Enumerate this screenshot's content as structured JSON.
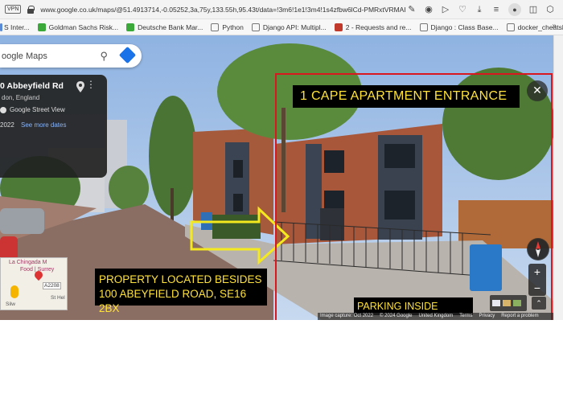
{
  "browser": {
    "vpn_label": "VPN",
    "url": "www.google.co.uk/maps/@51.4913714,-0.05252,3a,75y,133.55h,95.43t/data=!3m6!1e1!3m4!1s4zfbw6lCd-PMRxtVRMAIGA!2e0!7i",
    "toolbar_icons": [
      "edit-icon",
      "camera-icon",
      "play-icon",
      "heart-icon",
      "download-icon",
      "menu-icon",
      "profile-icon",
      "extension-icon",
      "settings-icon"
    ]
  },
  "bookmarks": [
    {
      "label": "S Inter...",
      "color": "#5a8bd6"
    },
    {
      "label": "Goldman Sachs Risk...",
      "color": "#3aa93a"
    },
    {
      "label": "Deutsche Bank Mar...",
      "color": "#3aa93a"
    },
    {
      "label": "Python",
      "color": "#555555"
    },
    {
      "label": "Django API: Multipl...",
      "color": "#555555"
    },
    {
      "label": "2 - Requests and re...",
      "color": "#c0392b"
    },
    {
      "label": "Django : Class Base...",
      "color": "#555555"
    },
    {
      "label": "docker_cheatsheet....",
      "color": "#555555"
    }
  ],
  "bookmarks_more": "»",
  "maps": {
    "search_brand": "oogle Maps",
    "info_card": {
      "address": "0 Abbeyfield Rd",
      "city": "don, England",
      "source": "Google Street View",
      "year": "2022",
      "see_more": "See more dates"
    },
    "minimap": {
      "place": "La Chingada M",
      "place2": "Food | Surrey",
      "road": "A2208",
      "street1": "St Hel",
      "street2": "Silw"
    },
    "zoom_in": "+",
    "zoom_out": "−",
    "close": "✕",
    "expand": "⌃",
    "footer": [
      "Image capture: Oct 2022",
      "© 2024 Google",
      "United Kingdom",
      "Terms",
      "Privacy",
      "Report a problem"
    ]
  },
  "annotations": {
    "entrance": "1 CAPE APARTMENT ENTRANCE",
    "property_line1": "PROPERTY LOCATED BESIDES",
    "property_line2": "100 ABEYFIELD ROAD, SE16 2BX",
    "parking": "PARKING INSIDE GATES",
    "box_color": "#d8181e",
    "text_color": "#ffe23a"
  }
}
